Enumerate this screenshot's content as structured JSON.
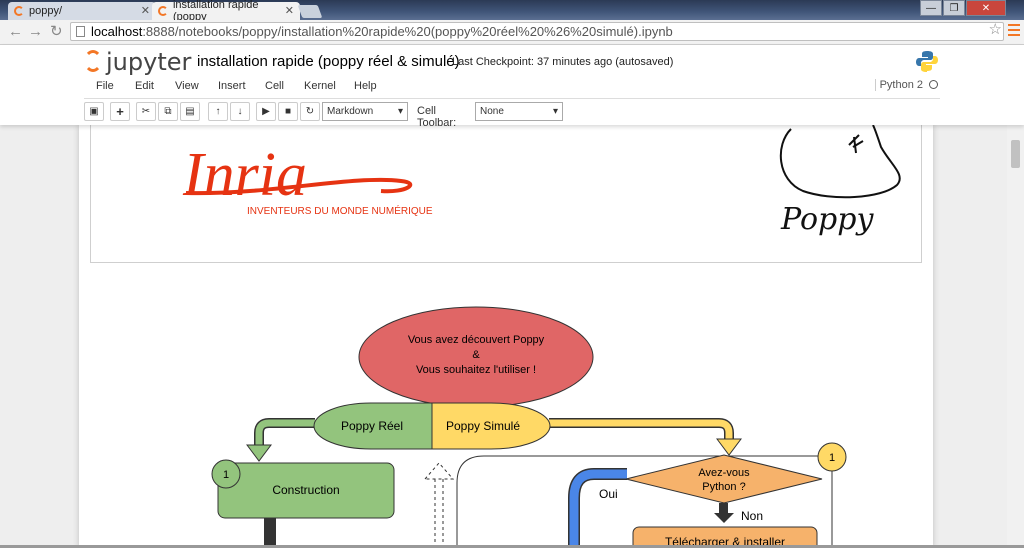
{
  "browser": {
    "tabs": [
      {
        "label": "poppy/",
        "active": false
      },
      {
        "label": "installation rapide (poppy",
        "active": true
      }
    ],
    "url_host": "localhost",
    "url_rest": ":8888/notebooks/poppy/installation%20rapide%20(poppy%20réel%20%26%20simulé).ipynb",
    "window_controls": [
      "—",
      "❐",
      "✕"
    ]
  },
  "jupyter": {
    "logo_text": "jupyter",
    "notebook_title": "installation rapide (poppy réel & simulé)",
    "checkpoint": "Last Checkpoint: 37 minutes ago (autosaved)",
    "menu": [
      "File",
      "Edit",
      "View",
      "Insert",
      "Cell",
      "Kernel",
      "Help"
    ],
    "kernel": "Python 2",
    "cell_type": "Markdown",
    "cell_toolbar_label": "Cell Toolbar:",
    "cell_toolbar_value": "None"
  },
  "images": {
    "inria_wordmark": "Inria",
    "inria_tagline": "INVENTEURS DU MONDE NUMÉRIQUE",
    "poppy_signature": "Poppy"
  },
  "flowchart": {
    "bubble_line1": "Vous avez découvert Poppy",
    "bubble_line2": "&",
    "bubble_line3": "Vous souhaitez l'utiliser !",
    "left_choice": "Poppy Réel",
    "right_choice": "Poppy Simulé",
    "step_badge_left": "1",
    "step_badge_right": "1",
    "construction": "Construction",
    "question_line1": "Avez-vous",
    "question_line2": "Python ?",
    "yes": "Oui",
    "no": "Non",
    "download": "Télécharger & installer",
    "colors": {
      "bubble": "#e06666",
      "real": "#93c47d",
      "sim": "#ffd966",
      "diamond": "#f6b26b",
      "blue": "#4a86e8"
    }
  }
}
